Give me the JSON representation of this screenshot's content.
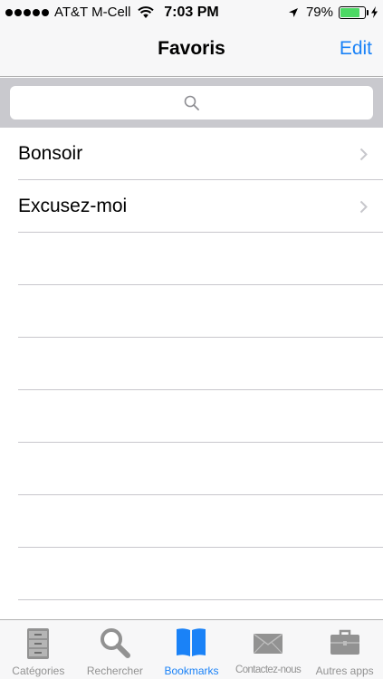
{
  "status_bar": {
    "carrier": "AT&T M-Cell",
    "time": "7:03 PM",
    "battery": "79%",
    "battery_level": 0.79,
    "signal_dots": 5
  },
  "nav": {
    "title": "Favoris",
    "edit_label": "Edit"
  },
  "search": {
    "placeholder": ""
  },
  "list": {
    "items": [
      {
        "label": "Bonsoir"
      },
      {
        "label": "Excusez-moi"
      }
    ],
    "empty_rows": 8
  },
  "tab_bar": {
    "tabs": [
      {
        "label": "Catégories",
        "icon": "filing-cabinet-icon"
      },
      {
        "label": "Rechercher",
        "icon": "magnifier-icon"
      },
      {
        "label": "Bookmarks",
        "icon": "book-icon",
        "active": true
      },
      {
        "label": "Contactez-nous",
        "icon": "envelope-icon"
      },
      {
        "label": "Autres apps",
        "icon": "briefcase-icon"
      }
    ]
  },
  "colors": {
    "accent": "#1a82f7",
    "inactive_tab": "#929292",
    "battery": "#4cd964",
    "search_bg": "#c9c9ce"
  }
}
